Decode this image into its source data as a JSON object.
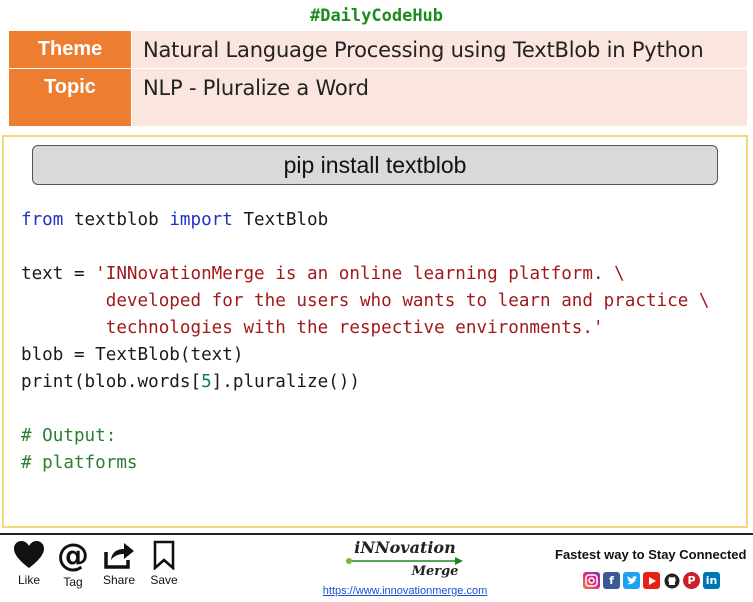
{
  "header": {
    "hashtag": "#DailyCodeHub",
    "theme_label": "Theme",
    "theme_value": "Natural Language Processing using TextBlob in Python",
    "topic_label": "Topic",
    "topic_value": "NLP - Pluralize a Word"
  },
  "install": {
    "command": "pip install textblob"
  },
  "code": {
    "l1_kw1": "from",
    "l1_mid": " textblob ",
    "l1_kw2": "import",
    "l1_end": " TextBlob",
    "l2_pre": "text = ",
    "l2_str": "'INNovationMerge is an online learning platform. \\",
    "l3_str": "        developed for the users who wants to learn and practice \\",
    "l4_str": "        technologies with the respective environments.'",
    "l5": "blob = TextBlob(text)",
    "l6_pre": "print(blob.words[",
    "l6_num": "5",
    "l6_end": "].pluralize())",
    "l7": "# Output:",
    "l8": "# platforms"
  },
  "footer": {
    "actions": {
      "like": "Like",
      "tag": "Tag",
      "share": "Share",
      "save": "Save"
    },
    "brand_line1": "iNNovation",
    "brand_line2": "Merge",
    "url": "https://www.innovationmerge.com",
    "connect_text": "Fastest way to Stay Connected",
    "social_icons": [
      "instagram-icon",
      "facebook-icon",
      "twitter-icon",
      "youtube-icon",
      "github-icon",
      "pinterest-icon",
      "linkedin-icon"
    ],
    "colors": {
      "instagram": "#d6249f",
      "facebook": "#3b5998",
      "twitter": "#1da1f2",
      "youtube": "#e62117",
      "github": "#222222",
      "pinterest": "#cb2027",
      "linkedin": "#0077b5"
    }
  },
  "colors": {
    "accent": "#ed7d31",
    "row_bg": "#fbe5df",
    "panel_border": "#f3d77a",
    "hashtag": "#1e8a1e"
  }
}
